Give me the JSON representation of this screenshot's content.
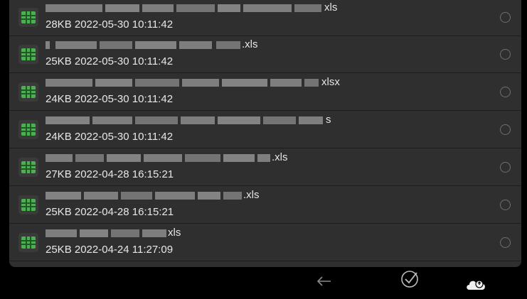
{
  "files": [
    {
      "ext_text": "xls",
      "meta": "28KB 2022-05-30 10:11:42"
    },
    {
      "ext_text": ".xls",
      "meta": "25KB 2022-05-30 10:11:42"
    },
    {
      "ext_text": "xlsx",
      "meta": "24KB 2022-05-30 10:11:42"
    },
    {
      "ext_text": "s",
      "meta": "24KB 2022-05-30 10:11:42"
    },
    {
      "ext_text": ".xls",
      "meta": "27KB 2022-04-28 16:15:21"
    },
    {
      "ext_text": ".xls",
      "meta": "25KB 2022-04-28 16:15:21"
    },
    {
      "ext_text": "xls",
      "meta": "25KB 2022-04-24 11:27:09"
    }
  ],
  "icons": {
    "file": "spreadsheet-icon",
    "select": "radio-icon",
    "back": "back-arrow-icon",
    "confirm": "check-circle-icon",
    "cloud": "cloud-upload-icon"
  },
  "colors": {
    "panel": "#2f2f2f",
    "background": "#000000",
    "spreadsheet_green": "#4caf50",
    "text": "#e8e8e8"
  }
}
